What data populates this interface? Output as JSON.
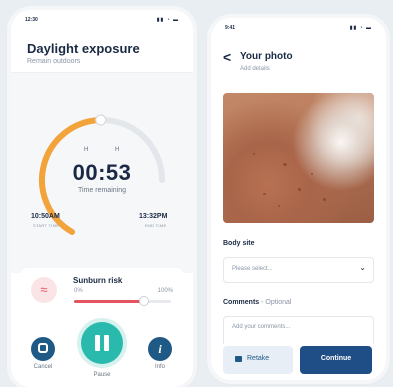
{
  "left_screen": {
    "status_time": "12:30",
    "status_icons": "▮▮ ◔ ▬",
    "title": "Daylight exposure",
    "subtitle": "Remain outdoors",
    "hour_marker_left": "H",
    "hour_marker_right": "H",
    "timer": "00:53",
    "timer_label": "Time remaining",
    "start_time": "10:50AM",
    "start_label": "START TIME",
    "end_time": "13:32PM",
    "end_label": "END TIME",
    "progress_fraction": 0.62,
    "sunburn": {
      "title": "Sunburn risk",
      "min_label": "0%",
      "max_label": "100%",
      "level": 0.72,
      "icon": "heat-waves-icon"
    },
    "actions": {
      "cancel_label": "Cancel",
      "pause_label": "Pause",
      "info_label": "Info",
      "info_glyph": "i"
    }
  },
  "right_screen": {
    "status_time": "9:41",
    "status_icons": "▮▮ ◔ ▬",
    "back_glyph": "<",
    "title": "Your photo",
    "subtitle": "Add details",
    "body_site_label": "Body site",
    "body_site_placeholder": "Please select...",
    "comments_label": "Comments",
    "comments_optional": " - Optional",
    "comments_placeholder": "Add your comments...",
    "retake_label": "Retake",
    "continue_label": "Continue"
  },
  "colors": {
    "accent_orange": "#f2a33a",
    "teal": "#29b9ad",
    "navy": "#1f5a86",
    "risk_red": "#e2545f"
  }
}
